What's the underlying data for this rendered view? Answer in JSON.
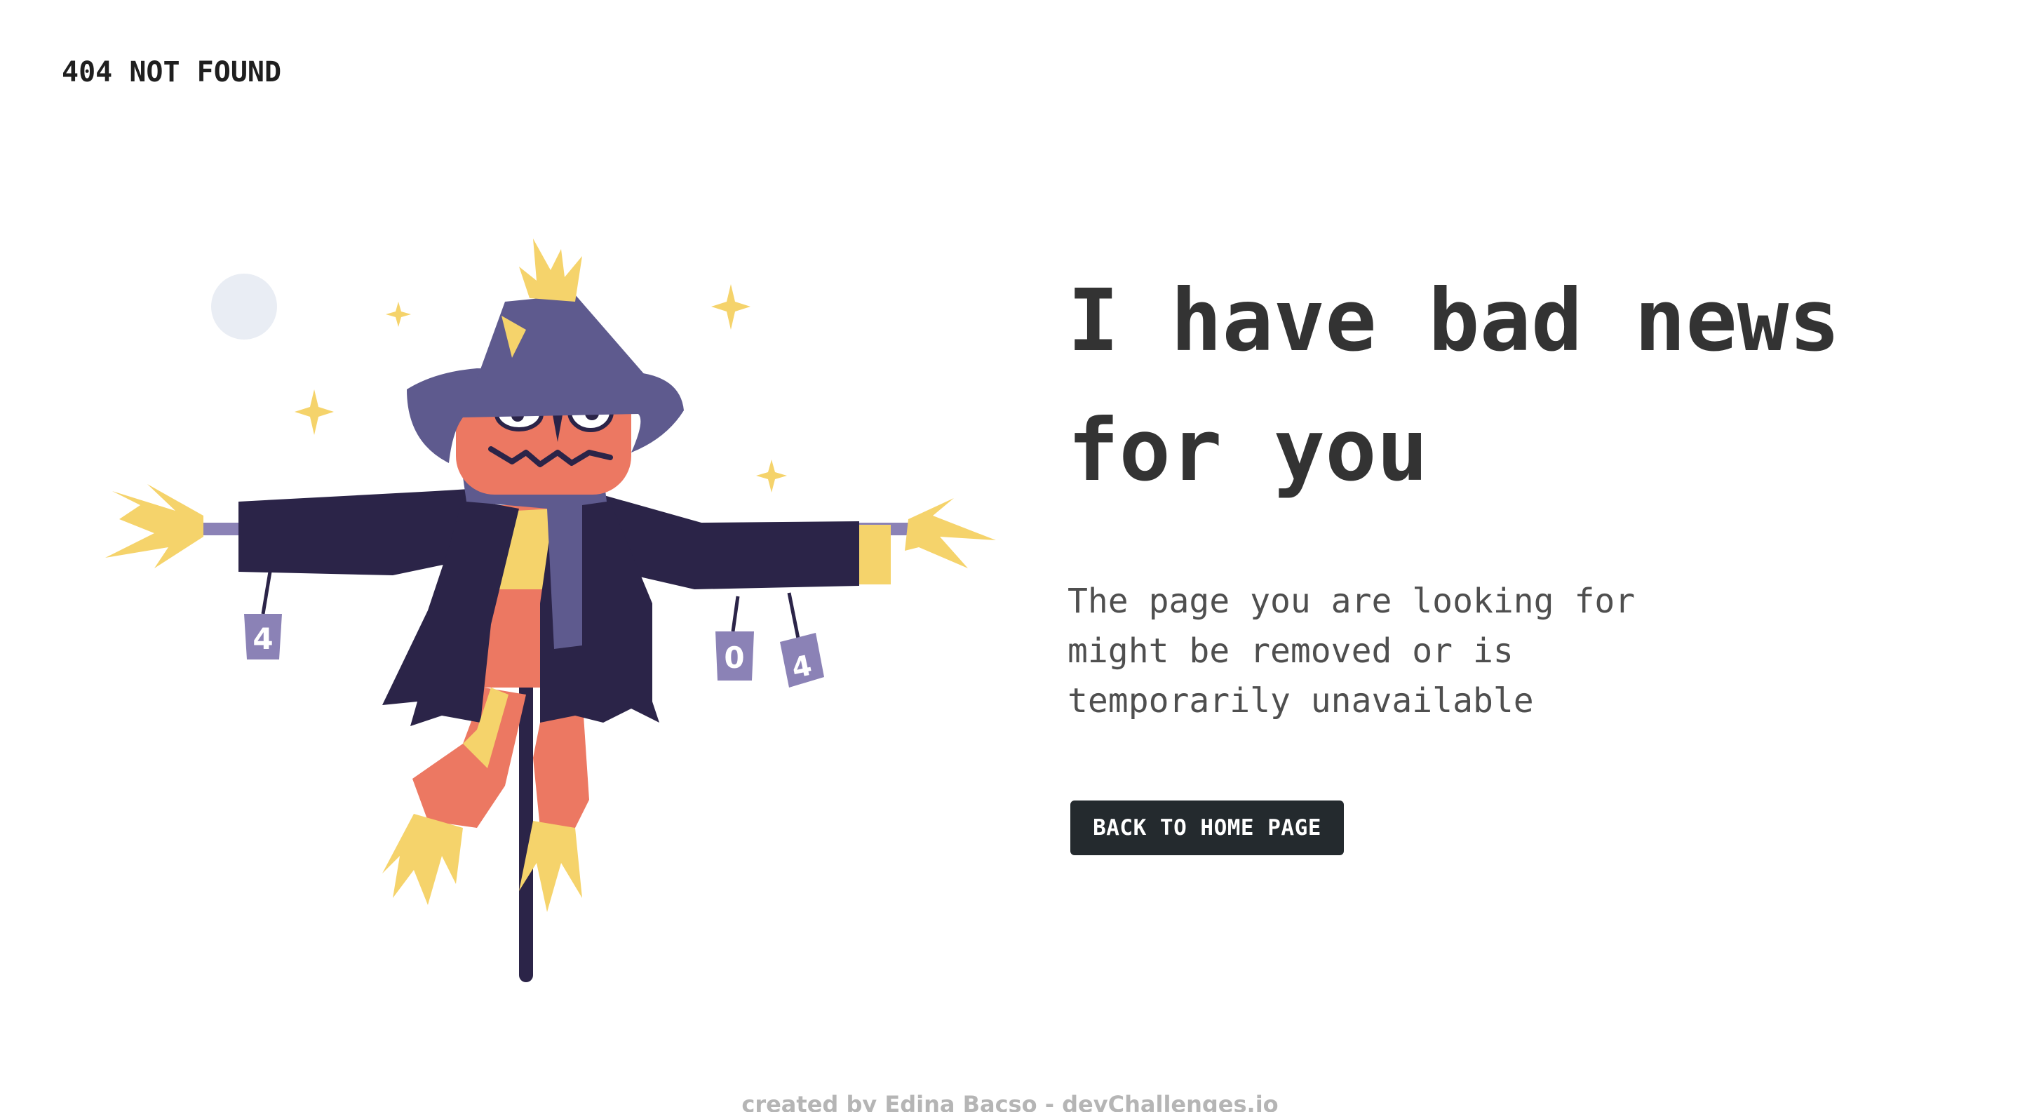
{
  "header": {
    "brand": "404 NOT FOUND"
  },
  "hero": {
    "headline_lines": [
      "I have bad news",
      "for you"
    ],
    "description_lines": [
      "The page you are looking for",
      "might be removed or is",
      "temporarily unavailable"
    ],
    "cta_label": "BACK TO HOME PAGE"
  },
  "illustration": {
    "cans": [
      "4",
      "0",
      "4"
    ]
  },
  "footer": {
    "credit": "created by Edina Bacso - devChallenges.io"
  },
  "colors": {
    "text_dark": "#333333",
    "button_bg": "#242a2e",
    "navy": "#2b2448",
    "purple": "#5e5a8e",
    "lilac": "#8b82b6",
    "coral": "#ec7862",
    "straw": "#f5d36b",
    "moon": "#e9edf4",
    "footer_text": "#b5b5b5"
  }
}
